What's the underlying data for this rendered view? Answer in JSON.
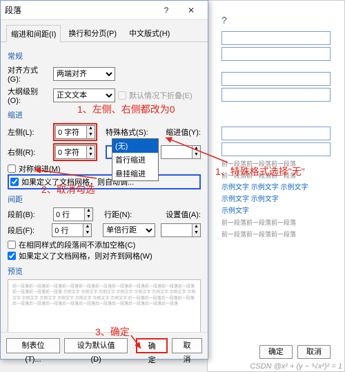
{
  "dialog": {
    "title": "段落",
    "help": "?",
    "close": "✕",
    "tabs": {
      "t1": "缩进和间距(I)",
      "t2": "换行和分页(P)",
      "t3": "中文版式(H)"
    },
    "general": {
      "title": "常规",
      "align_label": "对齐方式(G):",
      "align_value": "两端对齐",
      "outline_label": "大纲级别(O):",
      "outline_value": "正文文本",
      "collapse_label": "默认情况下折叠(E)"
    },
    "indent": {
      "title": "缩进",
      "left_label": "左侧(L):",
      "left_value": "0 字符",
      "right_label": "右侧(R):",
      "right_value": "0 字符",
      "special_label": "特殊格式(S):",
      "special_value": "",
      "indentval_label": "缩进值(Y):",
      "indentval_value": "",
      "dropdown": {
        "opt1": "(无)",
        "opt2": "首行缩进",
        "opt3": "悬挂缩进"
      },
      "mirror_label": "对称缩进(M)",
      "grid_label": "如果定义了文档网格，则自动调..."
    },
    "spacing": {
      "title": "间距",
      "before_label": "段前(B):",
      "before_value": "0 行",
      "after_label": "段后(F):",
      "after_value": "0 行",
      "linespace_label": "行距(N):",
      "linespace_value": "单倍行距",
      "setval_label": "设置值(A):",
      "setval_value": "",
      "nospace_label": "在相同样式的段落间不添加空格(C)",
      "grid_label": "如果定义了文档网格，则对齐到网格(W)"
    },
    "preview": {
      "title": "预览",
      "text": "前一段落前一段落前一段落前一段落前一段落前一段落前一段落前一段落前一段落前一段落前一段落前一段落前一段落前一段落\n示例文字 示例文字 示例文字 示例文字 示例文字 示例文字 示例文字 示例文字 示例文字 示例文字 示例文字 示例文字 示例文字 示例文字\n后一段落后一段落后一段落后一段落后一段落后一段落后一段落后一段落后一段落后一段落后一段落后一段落后一段落后一段落"
    },
    "footer": {
      "tabs_btn": "制表位(T)...",
      "default_btn": "设为默认值(D)",
      "ok": "确定",
      "cancel": "取消"
    }
  },
  "annotations": {
    "a1": "1、左侧、右侧都改为0",
    "a2": "2、取消勾选",
    "a3": "1、特殊格式选择\"无\"",
    "a4": "3、确定"
  },
  "bg": {
    "q": "?",
    "text1": "示例文字 示例文字 示例文字",
    "text2": "示例文字 示例文字",
    "text3": "示例文字",
    "g1": "前一段落前一段落前一段落",
    "ok": "确定",
    "cancel": "取消"
  },
  "watermark": "CSDN @x² + (y − ³√x²)² = 1"
}
